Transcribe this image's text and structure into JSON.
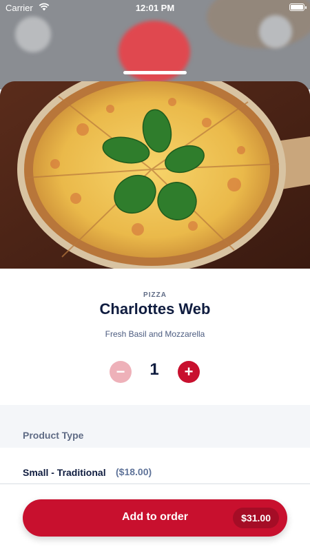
{
  "status_bar": {
    "carrier": "Carrier",
    "time": "12:01 PM"
  },
  "product": {
    "category": "PIZZA",
    "name": "Charlottes Web",
    "description": "Fresh Basil and Mozzarella",
    "image_icon": "pizza-photo"
  },
  "quantity": {
    "minus_symbol": "−",
    "value": "1",
    "plus_symbol": "+"
  },
  "options": {
    "section_title": "Product Type",
    "selected": {
      "name": "Small - Traditional",
      "price": "($18.00)"
    }
  },
  "order": {
    "button_label": "Add to order",
    "total": "$31.00"
  },
  "colors": {
    "accent": "#c8102e",
    "accent_light": "#eeb1b9",
    "text_primary": "#0f1c3f",
    "text_secondary": "#5f6b85"
  }
}
